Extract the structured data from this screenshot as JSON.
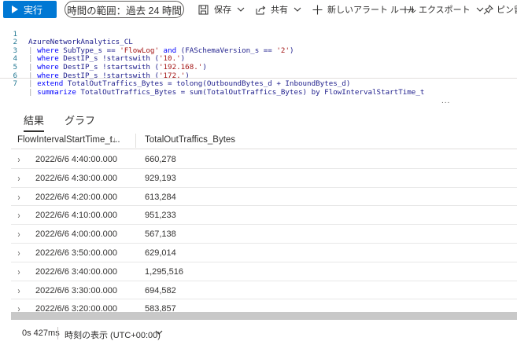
{
  "toolbar": {
    "run_label": "実行",
    "time_range_label": "時間の範囲：過去 24 時間",
    "save_label": "保存",
    "share_label": "共有",
    "new_alert_label": "新しいアラート ルール",
    "export_label": "エクスポート",
    "pin_label": "ピン留"
  },
  "editor": {
    "line_numbers": [
      "1",
      "2",
      "3",
      "4",
      "5",
      "6",
      "7"
    ],
    "table": "AzureNetworkAnalytics_CL",
    "l2": {
      "kw1": "where",
      "t1": " SubType_s == ",
      "s1": "'FlowLog'",
      "kw2": " and ",
      "t2": "(FASchemaVersion_s == ",
      "s2": "'2'",
      "t3": ")"
    },
    "l3": {
      "kw": "where",
      "t1": " DestIP_s !startswith (",
      "s": "'10.'",
      "t2": ")"
    },
    "l4": {
      "kw": "where",
      "t1": " DestIP_s !startswith (",
      "s": "'192.168.'",
      "t2": ")"
    },
    "l5": {
      "kw": "where",
      "t1": " DestIP_s !startswith (",
      "s": "'172.'",
      "t2": ")"
    },
    "l6": {
      "kw": "extend",
      "t1": " TotalOutTraffics_Bytes = tolong(OutboundBytes_d + InboundBytes_d)"
    },
    "l7": {
      "kw": "summarize",
      "t1": " TotalOutTraffics_Bytes = sum(TotalOutTraffics_Bytes) by FlowIntervalStartTime_t"
    },
    "more_dots": "..."
  },
  "results": {
    "tabs": [
      "結果",
      "グラフ"
    ],
    "columns": [
      "FlowIntervalStartTime_t...",
      "TotalOutTraffics_Bytes"
    ],
    "sort_icon": "↑↓",
    "rows": [
      {
        "time": "2022/6/6 4:40:00.000",
        "bytes": "660,278"
      },
      {
        "time": "2022/6/6 4:30:00.000",
        "bytes": "929,193"
      },
      {
        "time": "2022/6/6 4:20:00.000",
        "bytes": "613,284"
      },
      {
        "time": "2022/6/6 4:10:00.000",
        "bytes": "951,233"
      },
      {
        "time": "2022/6/6 4:00:00.000",
        "bytes": "567,138"
      },
      {
        "time": "2022/6/6 3:50:00.000",
        "bytes": "629,014"
      },
      {
        "time": "2022/6/6 3:40:00.000",
        "bytes": "1,295,516"
      },
      {
        "time": "2022/6/6 3:30:00.000",
        "bytes": "694,582"
      },
      {
        "time": "2022/6/6 3:20:00.000",
        "bytes": "583,857"
      }
    ]
  },
  "status": {
    "duration": "0s 427ms",
    "timezone": "時刻の表示 (UTC+00:00)"
  },
  "colors": {
    "accent": "#0078d4"
  }
}
